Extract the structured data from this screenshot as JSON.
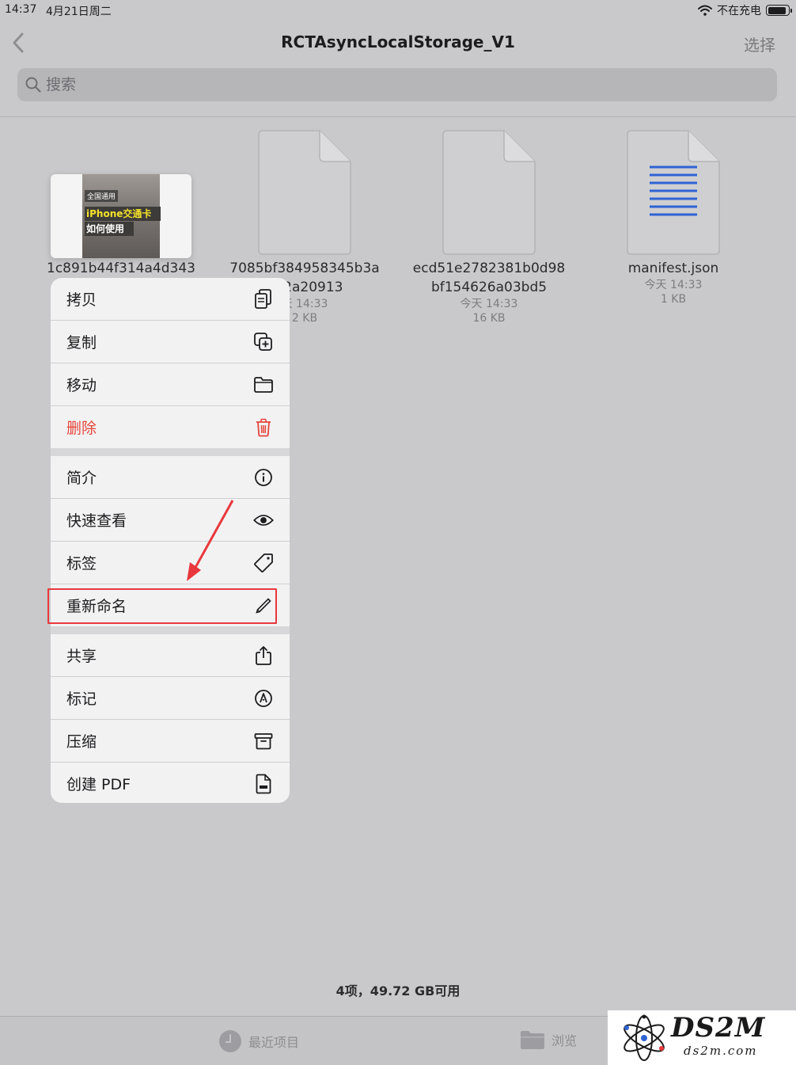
{
  "status": {
    "time": "14:37",
    "date": "4月21日周二",
    "charging": "不在充电"
  },
  "nav": {
    "title": "RCTAsyncLocalStorage_V1",
    "select": "选择"
  },
  "search": {
    "placeholder": "搜索"
  },
  "thumbnail": {
    "tag": "全国通用",
    "line1": "iPhone交通卡",
    "line2": "如何使用"
  },
  "files": [
    {
      "name1": "1c891b44f314a4d343"
    },
    {
      "name1": "7085bf384958345b3a",
      "name2": "502a20913",
      "date": "天 14:33",
      "size": "2 KB"
    },
    {
      "name1": "ecd51e2782381b0d98",
      "name2": "bf154626a03bd5",
      "date": "今天 14:33",
      "size": "16 KB"
    },
    {
      "name1": "manifest.json",
      "date": "今天 14:33",
      "size": "1 KB"
    }
  ],
  "menu": {
    "copy": "拷贝",
    "duplicate": "复制",
    "move": "移动",
    "delete": "删除",
    "info": "简介",
    "quicklook": "快速查看",
    "tags": "标签",
    "rename": "重新命名",
    "share": "共享",
    "markup": "标记",
    "compress": "压缩",
    "pdf": "创建 PDF"
  },
  "summary": "4项，49.72 GB可用",
  "tabs": {
    "recents": "最近项目",
    "browse": "浏览"
  },
  "watermark": {
    "brand": "DS2M",
    "site": "ds2m.com"
  },
  "colors": {
    "danger": "#e5453a",
    "highlight": "#e8383d",
    "doc_lines": "#2f63d4"
  }
}
